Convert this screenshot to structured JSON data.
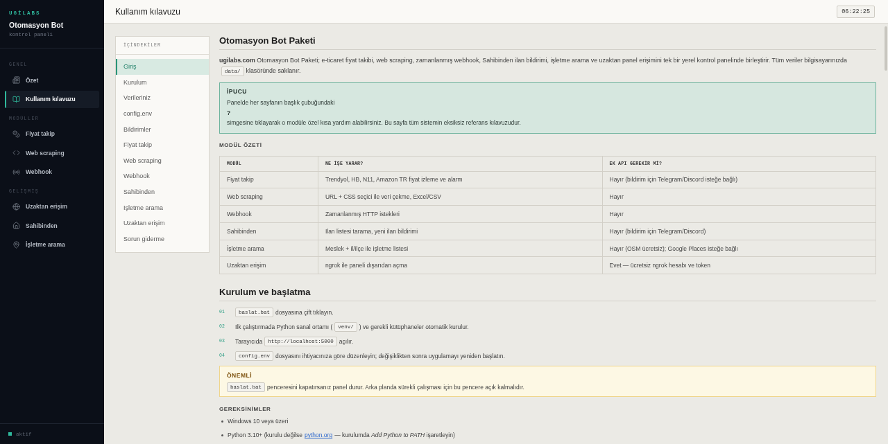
{
  "sidebar": {
    "brand": "UGİLABS",
    "title": "Otomasyon Bot",
    "subtitle": "kontrol paneli",
    "sections": [
      {
        "label": "GENEL",
        "items": [
          {
            "label": "Özet",
            "selected": false
          },
          {
            "label": "Kullanım kılavuzu",
            "selected": true
          }
        ]
      },
      {
        "label": "MODÜLLER",
        "items": [
          {
            "label": "Fiyat takip",
            "selected": false
          },
          {
            "label": "Web scraping",
            "selected": false
          },
          {
            "label": "Webhook",
            "selected": false
          }
        ]
      },
      {
        "label": "GELİŞMİŞ",
        "items": [
          {
            "label": "Uzaktan erişim",
            "selected": false
          },
          {
            "label": "Sahibinden",
            "selected": false
          },
          {
            "label": "İşletme arama",
            "selected": false
          }
        ]
      }
    ],
    "status": "aktif"
  },
  "header": {
    "title": "Kullanım kılavuzu",
    "clock": "06:22:25"
  },
  "toc": {
    "title": "İÇİNDEKİLER",
    "items": [
      {
        "label": "Giriş",
        "selected": true
      },
      {
        "label": "Kurulum",
        "selected": false
      },
      {
        "label": "Verileriniz",
        "selected": false
      },
      {
        "label": "config.env",
        "selected": false
      },
      {
        "label": "Bildirimler",
        "selected": false
      },
      {
        "label": "Fiyat takip",
        "selected": false
      },
      {
        "label": "Web scraping",
        "selected": false
      },
      {
        "label": "Webhook",
        "selected": false
      },
      {
        "label": "Sahibinden",
        "selected": false
      },
      {
        "label": "Işletme arama",
        "selected": false
      },
      {
        "label": "Uzaktan erişim",
        "selected": false
      },
      {
        "label": "Sorun giderme",
        "selected": false
      }
    ]
  },
  "intro": {
    "title": "Otomasyon Bot Paketi",
    "parts": [
      {
        "kind": "text",
        "text": "**ugilabs.com** Otomasyon Bot Paketi; e-ticaret fiyat takibi, web scraping, zamanlanmış webhook, Sahibinden ilan bildirimi, işletme arama ve uzaktan panel erişimini tek bir yerel kontrol panelinde birleştirir. Tüm veriler bilgisayarınızda"
      },
      {
        "kind": "code",
        "text": "data/"
      },
      {
        "kind": "text",
        "text": "klasöründe saklanır."
      }
    ]
  },
  "tip": {
    "title": "İPUCU",
    "text": "Panelde her sayfanın başlık çubuğundaki **?** simgesine tıklayarak o modüle özel kısa yardım alabilirsiniz. Bu sayfa tüm sistemin eksiksiz referans kılavuzudur."
  },
  "module_summary": {
    "title": "MODÜL ÖZETİ",
    "columns": [
      "MODÜL",
      "NE İŞE YARAR?",
      "EK API GEREKİR Mİ?"
    ],
    "rows": [
      [
        "Fiyat takip",
        "Trendyol, HB, N11, Amazon TR fiyat izleme ve alarm",
        "Hayır (bildirim için Telegram/Discord isteğe bağlı)"
      ],
      [
        "Web scraping",
        "URL + CSS seçici ile veri çekme, Excel/CSV",
        "Hayır"
      ],
      [
        "Webhook",
        "Zamanlanmış HTTP istekleri",
        "Hayır"
      ],
      [
        "Sahibinden",
        "Ilan listesi tarama, yeni ilan bildirimi",
        "Hayır (bildirim için Telegram/Discord)"
      ],
      [
        "İşletme arama",
        "Meslek + il/ilçe ile işletme listesi",
        "Hayır (OSM ücretsiz); Google Places isteğe bağlı"
      ],
      [
        "Uzaktan erişim",
        "ngrok ile paneli dışarıdan açma",
        "Evet — ücretsiz ngrok hesabı ve token"
      ]
    ]
  },
  "setup": {
    "title": "Kurulum ve başlatma",
    "steps": [
      {
        "number": "01",
        "parts": [
          {
            "kind": "code",
            "text": "baslat.bat"
          },
          {
            "kind": "text",
            "text": "dosyasına çift tıklayın."
          }
        ]
      },
      {
        "number": "02",
        "parts": [
          {
            "kind": "text",
            "text": "Ilk çalıştırmada Python sanal ortamı ("
          },
          {
            "kind": "code",
            "text": "venv/"
          },
          {
            "kind": "text",
            "text": ") ve gerekli kütüphaneler otomatik kurulur."
          }
        ]
      },
      {
        "number": "03",
        "parts": [
          {
            "kind": "text",
            "text": "Tarayıcıda"
          },
          {
            "kind": "code",
            "text": "http://localhost:5000"
          },
          {
            "kind": "text",
            "text": "açılır."
          }
        ]
      },
      {
        "number": "04",
        "parts": [
          {
            "kind": "code",
            "text": "config.env"
          },
          {
            "kind": "text",
            "text": "dosyasını ihtiyacınıza göre düzenleyin; değişiklikten sonra uygulamayı yeniden başlatın."
          }
        ]
      }
    ]
  },
  "warning": {
    "title": "ÖNEMLİ",
    "parts": [
      {
        "kind": "code",
        "text": "baslat.bat"
      },
      {
        "kind": "text",
        "text": "penceresini kapatırsanız panel durur. Arka planda sürekli çalışması için bu pencere açık kalmalıdır."
      }
    ]
  },
  "requirements": {
    "title": "GEREKSİNİMLER",
    "items": [
      {
        "parts": [
          {
            "kind": "text",
            "text": "Windows 10 veya üzeri"
          }
        ]
      },
      {
        "parts": [
          {
            "kind": "text",
            "text": "Python 3.10+ (kurulu değilse"
          },
          {
            "kind": "link",
            "text": "python.org"
          },
          {
            "kind": "text",
            "text": "— kurulumda *Add Python to PATH* işaretleyin)"
          }
        ]
      }
    ]
  }
}
